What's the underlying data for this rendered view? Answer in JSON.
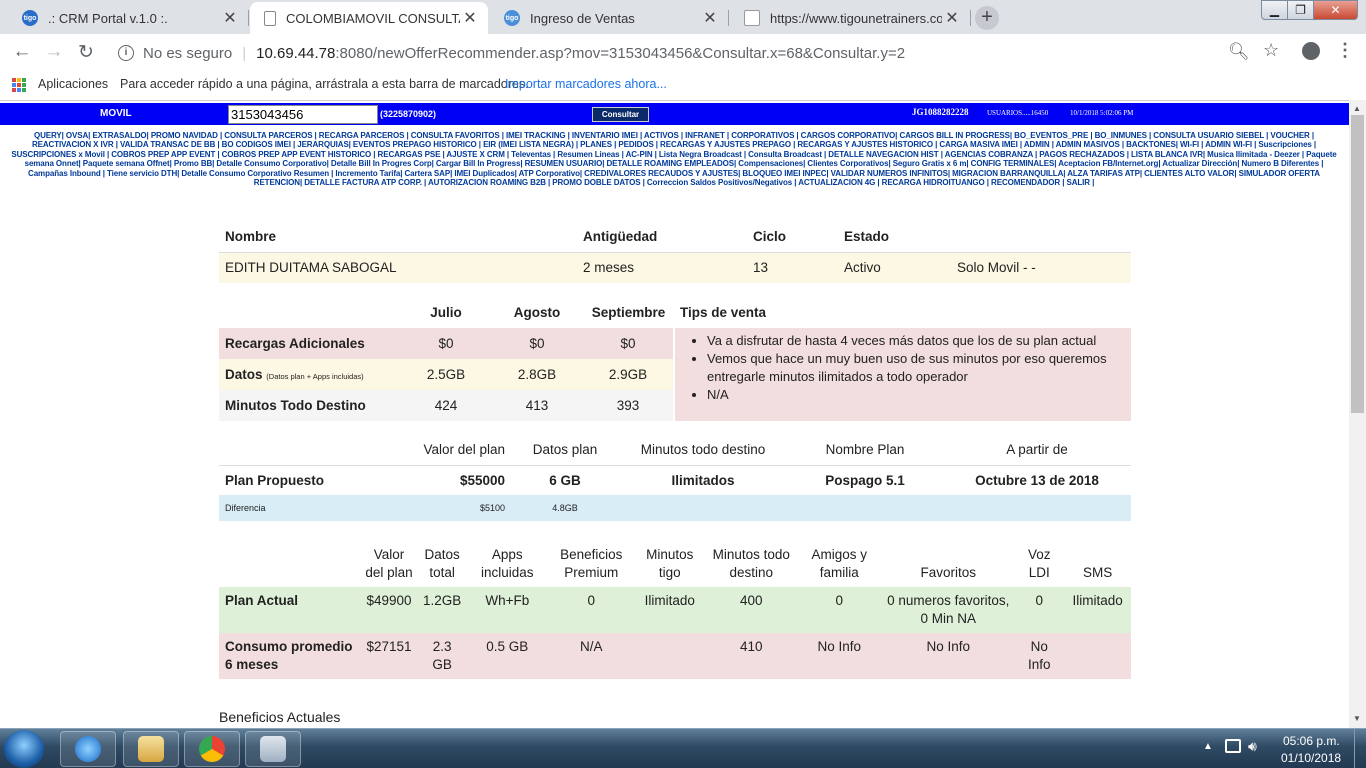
{
  "browser": {
    "tabs": [
      {
        "title": ".: CRM Portal v.1.0 :.",
        "active": false
      },
      {
        "title": "COLOMBIAMOVIL CONSULTA IN",
        "active": true
      },
      {
        "title": "Ingreso de Ventas",
        "active": false
      },
      {
        "title": "https://www.tigounetrainers.com",
        "active": false
      }
    ],
    "security_label": "No es seguro",
    "url_host": "10.69.44.78",
    "url_path": ":8080/newOfferRecommender.asp?mov=3153043456&Consultar.x=68&Consultar.y=2",
    "bookmarks": {
      "apps_label": "Aplicaciones",
      "hint": "Para acceder rápido a una página, arrástrala a esta barra de marcadores.",
      "import_link": "Importar marcadores ahora..."
    }
  },
  "header": {
    "movil_label": "MOVIL",
    "phone_value": "3153043456",
    "alt_number": "(3225870902)",
    "consultar_label": "Consultar",
    "user_code": "JG1088282228",
    "user_count": "USUARIOS.....16450",
    "datetime": "10/1/2018 5:02:06 PM"
  },
  "menu_links": "QUERY| OVSA| EXTRASALDO| PROMO NAVIDAD | CONSULTA PARCEROS | RECARGA PARCEROS | CONSULTA FAVORITOS | IMEI TRACKING | INVENTARIO IMEI | ACTIVOS | INFRANET | CORPORATIVOS | CARGOS CORPORATIVO| CARGOS BILL IN PROGRESS| BO_EVENTOS_PRE | BO_INMUNES | CONSULTA USUARIO SIEBEL | VOUCHER | REACTIVACION X IVR | VALIDA TRANSAC DE BB | BO CODIGOS IMEI | JERARQUIAS| EVENTOS PREPAGO HISTORICO | EIR (IMEI LISTA NEGRA) | PLANES | PEDIDOS | RECARGAS Y AJUSTES PREPAGO | RECARGAS Y AJUSTES HISTORICO | CARGA MASIVA IMEI | ADMIN | ADMIN MASIVOS | BACKTONES| WI-FI | ADMIN WI-FI | Suscripciones | SUSCRIPCIONES x Movil | COBROS PREP APP EVENT | COBROS PREP APP EVENT HISTORICO | RECARGAS PSE | AJUSTE X CRM | Televentas | Resumen Lineas | AC-PIN | Lista Negra Broadcast | Consulta Broadcast | DETALLE NAVEGACION HIST | AGENCIAS COBRANZA | PAGOS RECHAZADOS | LISTA BLANCA IVR| Musica Ilimitada - Deezer | Paquete semana Onnet| Paquete semana Offnet| Promo BB| Detalle Consumo Corporativo| Detalle Bill In Progres Corp| Cargar Bill In Progress| RESUMEN USUARIO| DETALLE ROAMING EMPLEADOS| Compensaciones| Clientes Corporativos| Seguro Gratis x 6 m| CONFIG TERMINALES| Aceptacion FB/Internet.org| Actualizar Dirección| Numero B Diferentes | Campañas Inbound | Tiene servicio DTH| Detalle Consumo Corporativo Resumen | Incremento Tarifa| Cartera SAP| IMEI Duplicados| ATP Corporativo| CREDIVALORES RECAUDOS Y AJUSTES| BLOQUEO IMEI INPEC| VALIDAR NUMEROS INFINITOS| MIGRACION BARRANQUILLA| ALZA TARIFAS ATP| CLIENTES ALTO VALOR| SIMULADOR OFERTA RETENCION| DETALLE FACTURA ATP CORP. | AUTORIZACION ROAMING B2B | PROMO DOBLE DATOS | Correccion Saldos Positivos/Negativos | ACTUALIZACION 4G | RECARGA HIDROITUANGO | RECOMENDADOR | SALIR |",
  "client": {
    "headers": {
      "nombre": "Nombre",
      "antiguedad": "Antigüedad",
      "ciclo": "Ciclo",
      "estado": "Estado"
    },
    "nombre": "EDITH DUITAMA SABOGAL",
    "antiguedad": "2 meses",
    "ciclo": "13",
    "estado": "Activo",
    "tipo": "Solo Movil - -"
  },
  "usage": {
    "months": [
      "Julio",
      "Agosto",
      "Septiembre"
    ],
    "tips_header": "Tips de venta",
    "rows": [
      {
        "label": "Recargas Adicionales",
        "note": "",
        "values": [
          "$0",
          "$0",
          "$0"
        ]
      },
      {
        "label": "Datos",
        "note": "(Datos plan + Apps incluidas)",
        "values": [
          "2.5GB",
          "2.8GB",
          "2.9GB"
        ]
      },
      {
        "label": "Minutos Todo Destino",
        "note": "",
        "values": [
          "424",
          "413",
          "393"
        ]
      }
    ],
    "tips": [
      "Va a disfrutar de hasta 4 veces más datos que los de su plan actual",
      "Vemos que hace un muy buen uso de sus minutos por eso queremos entregarle minutos ilimitados a todo operador",
      "N/A"
    ]
  },
  "proposed_plan": {
    "headers": [
      "Valor del plan",
      "Datos plan",
      "Minutos todo destino",
      "Nombre Plan",
      "A partir de"
    ],
    "label": "Plan Propuesto",
    "valor": "$55000",
    "datos": "6 GB",
    "minutos": "Ilimitados",
    "nombre": "Pospago 5.1",
    "desde": "Octubre 13 de 2018",
    "diff_label": "Diferencia",
    "diff_valor": "$5100",
    "diff_datos": "4.8GB"
  },
  "current_plan": {
    "headers": [
      "Valor del plan",
      "Datos total",
      "Apps incluidas",
      "Beneficios Premium",
      "Minutos tigo",
      "Minutos todo destino",
      "Amigos y familia",
      "Favoritos",
      "Voz LDI",
      "SMS"
    ],
    "actual": {
      "label": "Plan Actual",
      "values": [
        "$49900",
        "1.2GB",
        "Wh+Fb",
        "0",
        "Ilimitado",
        "400",
        "0",
        "0 numeros favoritos, 0 Min NA",
        "0",
        "Ilimitado"
      ]
    },
    "consumo": {
      "label": "Consumo promedio 6 meses",
      "values": [
        "$27151",
        "2.3 GB",
        "0.5 GB",
        "N/A",
        "",
        "410",
        "No Info",
        "No Info",
        "No Info",
        ""
      ]
    }
  },
  "benefits_title": "Beneficios Actuales",
  "taskbar": {
    "time": "05:06 p.m.",
    "date": "01/10/2018"
  },
  "colors": {
    "header_blue": "#0000f5",
    "link_blue": "#003a99",
    "row_pink": "#f2dede",
    "row_yellow": "#fcf8e3",
    "row_green": "#dff0d8",
    "row_blue": "#d9edf7"
  }
}
